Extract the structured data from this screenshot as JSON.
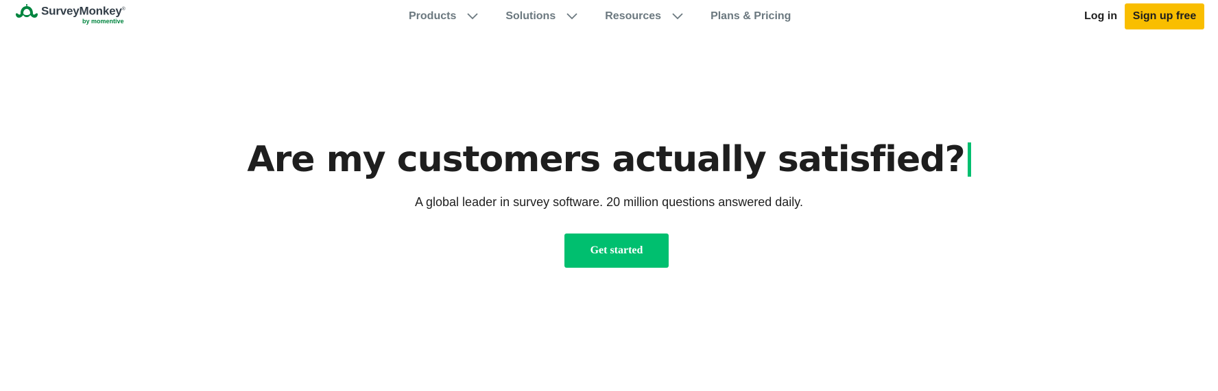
{
  "brand": {
    "name": "SurveyMonkey",
    "trademark": "®",
    "byline": "by momentive",
    "colors": {
      "green": "#00bf6f",
      "dark_green": "#00853f",
      "yellow": "#f9be00",
      "text": "#1e1e1e",
      "nav_text": "#6b787f"
    }
  },
  "nav": {
    "items": [
      {
        "label": "Products",
        "has_dropdown": true,
        "icon": "chevron-down-icon"
      },
      {
        "label": "Solutions",
        "has_dropdown": true,
        "icon": "chevron-down-icon"
      },
      {
        "label": "Resources",
        "has_dropdown": true,
        "icon": "chevron-down-icon"
      },
      {
        "label": "Plans & Pricing",
        "has_dropdown": false
      }
    ]
  },
  "header_actions": {
    "login_label": "Log in",
    "signup_label": "Sign up free"
  },
  "hero": {
    "title": "Are my customers actually satisfied?",
    "subtitle": "A global leader in survey software. 20 million questions answered daily.",
    "cta_label": "Get started"
  }
}
